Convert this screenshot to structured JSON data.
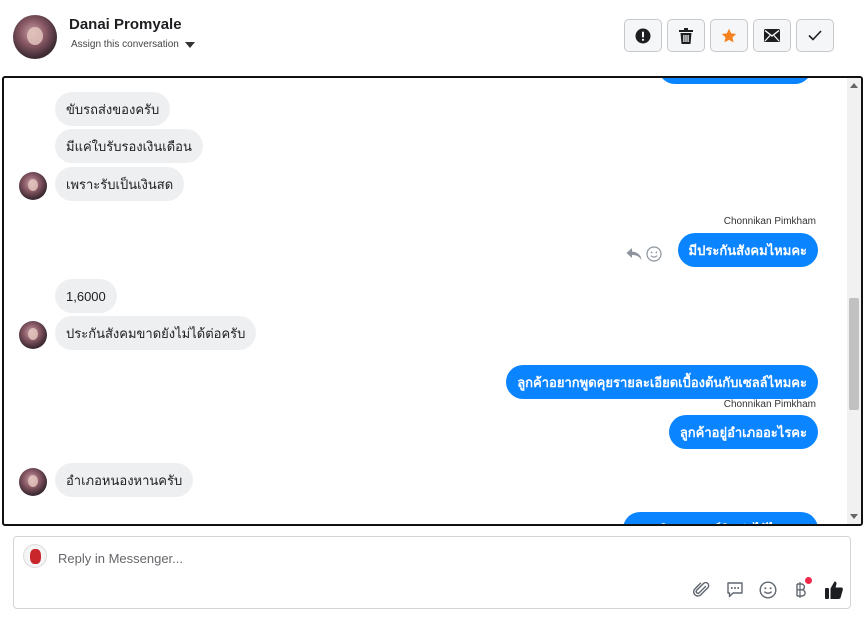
{
  "header": {
    "contact_name": "Danai Promyale",
    "assign_label": "Assign this conversation",
    "actions": [
      {
        "name": "mark-spam-button",
        "icon": "exclamation-circle-icon"
      },
      {
        "name": "delete-button",
        "icon": "trash-icon"
      },
      {
        "name": "star-button",
        "icon": "star-icon",
        "color": "#f5821f"
      },
      {
        "name": "mark-unread-button",
        "icon": "envelope-icon"
      },
      {
        "name": "mark-done-button",
        "icon": "checkmark-icon"
      }
    ]
  },
  "messages": [
    {
      "side": "in",
      "text": "ขับรถส่งของครับ"
    },
    {
      "side": "in",
      "text": "มีแค่ใบรับรองเงินเดือน"
    },
    {
      "side": "in",
      "text": "เพราะรับเป็นเงินสด"
    },
    {
      "side": "out",
      "sender": "Chonnikan Pimkham",
      "text": "มีประกันสังคมไหมคะ"
    },
    {
      "side": "in",
      "text": "1,6000"
    },
    {
      "side": "in",
      "text": "ประกันสังคมขาดยังไม่ได้ต่อครับ"
    },
    {
      "side": "out",
      "text": "ลูกค้าอยากพูดคุยรายละเอียดเบื้องต้นกับเซลล์ไหมคะ"
    },
    {
      "side": "out",
      "sender": "Chonnikan Pimkham",
      "text": "ลูกค้าอยู่อำเภออะไรคะ"
    },
    {
      "side": "in",
      "text": "อำเภอหนองหานครับ"
    },
    {
      "side": "out",
      "text": "แอดมินขอเบอร์ติดต่อไว้ไหมคะ"
    }
  ],
  "composer": {
    "placeholder": "Reply in Messenger...",
    "tools": [
      "paperclip-icon",
      "saved-reply-icon",
      "emoji-icon",
      "baht-payment-icon",
      "thumbs-up-icon"
    ],
    "notification_color": "#f02849"
  },
  "colors": {
    "outgoing_bubble": "#0b84ff",
    "incoming_bubble": "#eeeff1"
  }
}
